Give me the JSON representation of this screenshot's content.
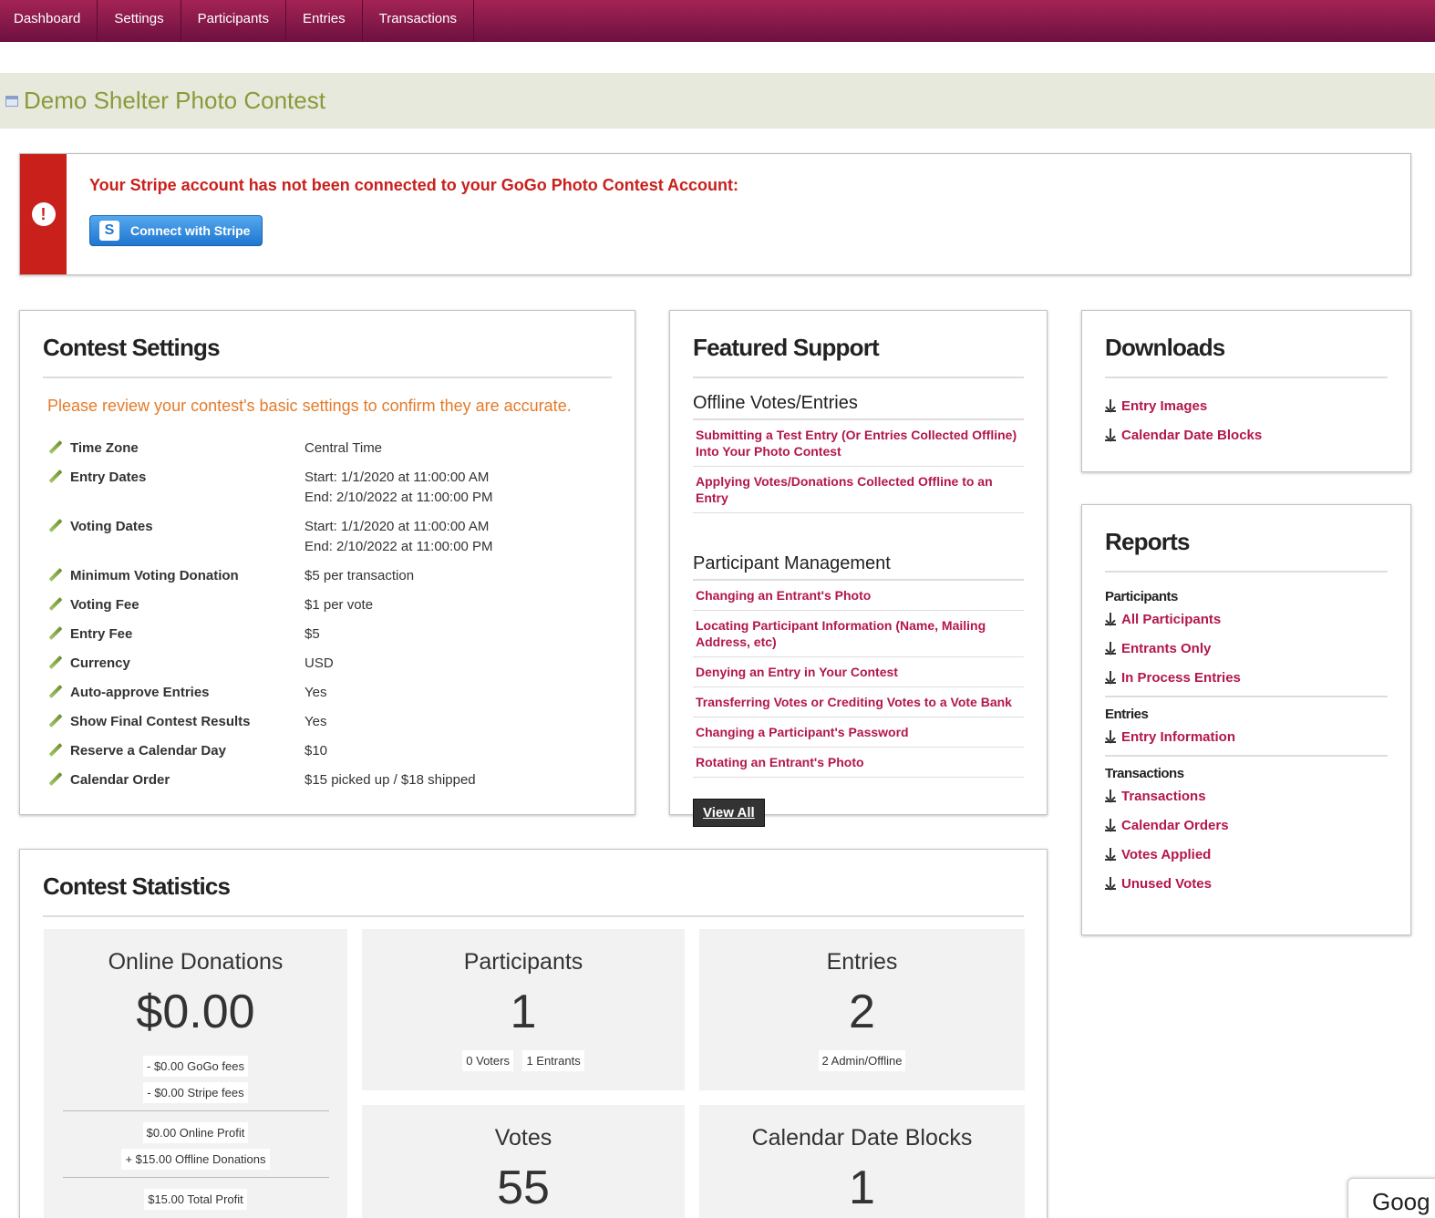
{
  "nav": [
    "Dashboard",
    "Settings",
    "Participants",
    "Entries",
    "Transactions"
  ],
  "page_title": "Demo Shelter Photo Contest",
  "alert": {
    "message": "Your Stripe account has not been connected to your GoGo Photo Contest Account:",
    "button_label": "Connect with Stripe",
    "icon_text": "!"
  },
  "settings": {
    "title": "Contest Settings",
    "review_note": "Please review your contest's basic settings to confirm they are accurate.",
    "rows": [
      {
        "label": "Time Zone",
        "value": "Central Time"
      },
      {
        "label": "Entry Dates",
        "value": "Start: 1/1/2020 at 11:00:00 AM",
        "value2": "End: 2/10/2022 at 11:00:00 PM"
      },
      {
        "label": "Voting Dates",
        "value": "Start: 1/1/2020 at 11:00:00 AM",
        "value2": "End: 2/10/2022 at 11:00:00 PM"
      },
      {
        "label": "Minimum Voting Donation",
        "value": "$5 per transaction"
      },
      {
        "label": "Voting Fee",
        "value": "$1 per vote"
      },
      {
        "label": "Entry Fee",
        "value": "$5"
      },
      {
        "label": "Currency",
        "value": "USD"
      },
      {
        "label": "Auto-approve Entries",
        "value": "Yes"
      },
      {
        "label": "Show Final Contest Results",
        "value": "Yes"
      },
      {
        "label": "Reserve a Calendar Day",
        "value": "$10"
      },
      {
        "label": "Calendar Order",
        "value": "$15 picked up / $18 shipped"
      }
    ]
  },
  "support": {
    "title": "Featured Support",
    "sections": [
      {
        "heading": "Offline Votes/Entries",
        "links": [
          "Submitting a Test Entry (Or Entries Collected Offline) Into Your Photo Contest",
          "Applying Votes/Donations Collected Offline to an Entry"
        ]
      },
      {
        "heading": "Participant Management",
        "links": [
          "Changing an Entrant's Photo",
          "Locating Participant Information (Name, Mailing Address, etc)",
          "Denying an Entry in Your Contest",
          "Transferring Votes or Crediting Votes to a Vote Bank",
          "Changing a Participant's Password",
          "Rotating an Entrant's Photo"
        ]
      }
    ],
    "view_all": "View All"
  },
  "downloads": {
    "title": "Downloads",
    "links": [
      "Entry Images",
      "Calendar Date Blocks"
    ]
  },
  "reports": {
    "title": "Reports",
    "groups": [
      {
        "name": "Participants",
        "links": [
          "All Participants",
          "Entrants Only",
          "In Process Entries"
        ]
      },
      {
        "name": "Entries",
        "links": [
          "Entry Information"
        ]
      },
      {
        "name": "Transactions",
        "links": [
          "Transactions",
          "Calendar Orders",
          "Votes Applied",
          "Unused Votes"
        ]
      }
    ]
  },
  "stats": {
    "title": "Contest Statistics",
    "donations": {
      "title": "Online Donations",
      "value": "$0.00",
      "gogo_fees": "- $0.00 GoGo fees",
      "stripe_fees": "- $0.00 Stripe fees",
      "online_profit": "$0.00 Online Profit",
      "offline_donations": "+ $15.00 Offline Donations",
      "total_profit": "$15.00 Total Profit"
    },
    "participants": {
      "title": "Participants",
      "value": "1",
      "chip1": "0 Voters",
      "chip2": "1 Entrants"
    },
    "entries": {
      "title": "Entries",
      "value": "2",
      "chip1": "2 Admin/Offline"
    },
    "votes": {
      "title": "Votes",
      "value": "55"
    },
    "calendar": {
      "title": "Calendar Date Blocks",
      "value": "1"
    }
  },
  "corner_widget_text": "Goog"
}
